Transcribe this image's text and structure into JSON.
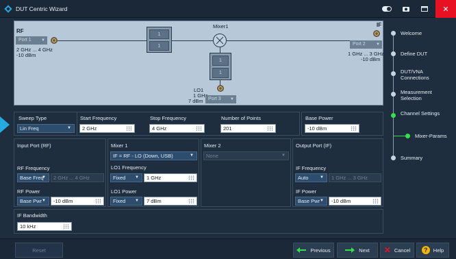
{
  "window": {
    "title": "DUT Centric Wizard"
  },
  "diagram": {
    "rf_label": "RF",
    "rf_port": "Port 1",
    "rf_freq": "2 GHz ... 4 GHz",
    "rf_power": "-10 dBm",
    "if_label": "IF",
    "if_port": "Port 2",
    "if_freq": "1 GHz ... 3 GHz",
    "if_power": "-10 dBm",
    "mixer_label": "Mixer1",
    "lo_label": "LO1",
    "lo_freq": "1 GHz",
    "lo_power": "7 dBm",
    "lo_port": "Port 3",
    "cell_values": [
      "1",
      "1",
      "1",
      "1"
    ]
  },
  "nav": {
    "items": [
      {
        "label": "Welcome"
      },
      {
        "label": "Define DUT"
      },
      {
        "label": "DUT/VNA Connections"
      },
      {
        "label": "Measurement Selection"
      },
      {
        "label": "Channel Settings"
      },
      {
        "label": "Mixer-Params"
      },
      {
        "label": "Summary"
      }
    ]
  },
  "sweep": {
    "type_label": "Sweep Type",
    "type_value": "Lin Freq",
    "start_label": "Start Frequency",
    "start_value": "2 GHz",
    "stop_label": "Stop Frequency",
    "stop_value": "4 GHz",
    "points_label": "Number of Points",
    "points_value": "201",
    "power_label": "Base Power",
    "power_value": "-10 dBm"
  },
  "input_port": {
    "title": "Input Port (RF)",
    "freq_label": "RF Frequency",
    "freq_mode": "Base Freq",
    "freq_value": "2 GHz ... 4 GHz",
    "power_label": "RF Power",
    "power_mode": "Base Pwr",
    "power_value": "-10 dBm"
  },
  "mixer1": {
    "title": "Mixer 1",
    "formula": "IF = RF - LO (Down, USB)",
    "lo_freq_label": "LO1 Frequency",
    "lo_freq_mode": "Fixed",
    "lo_freq_value": "1 GHz",
    "lo_power_label": "LO1 Power",
    "lo_power_mode": "Fixed",
    "lo_power_value": "7 dBm"
  },
  "mixer2": {
    "title": "Mixer 2",
    "value": "None"
  },
  "output_port": {
    "title": "Output Port (IF)",
    "freq_label": "IF Frequency",
    "freq_mode": "Auto",
    "freq_value": "1 GHz ... 3 GHz",
    "power_label": "IF Power",
    "power_mode": "Base Pwr",
    "power_value": "-10 dBm"
  },
  "if_bw": {
    "label": "IF Bandwidth",
    "value": "10 kHz"
  },
  "buttons": {
    "reset": "Reset",
    "previous": "Previous",
    "next": "Next",
    "cancel": "Cancel",
    "help": "Help"
  },
  "colors": {
    "accent": "#27a9e1",
    "active": "#35e04a",
    "close": "#e81123"
  }
}
